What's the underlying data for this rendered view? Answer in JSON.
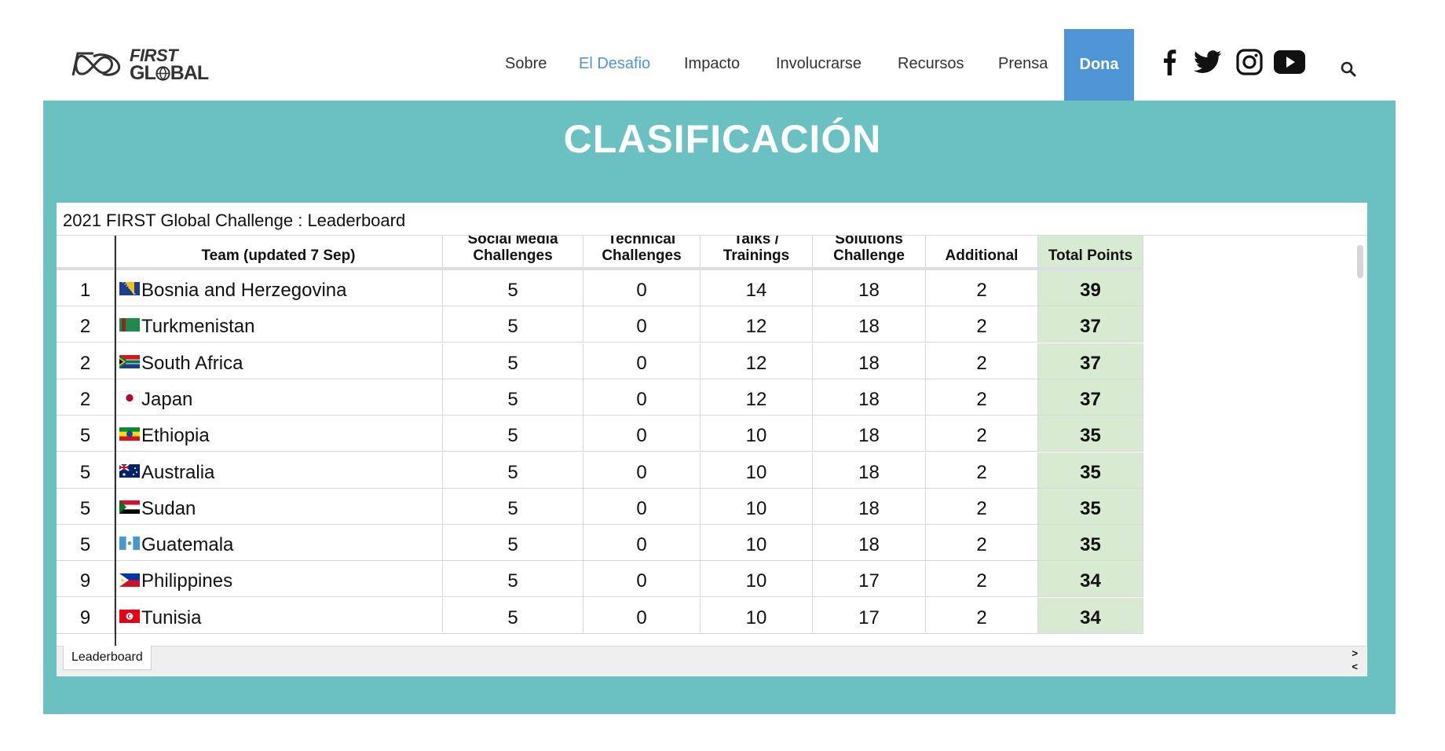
{
  "brand": {
    "line1": "FIRST",
    "line2": "GL",
    "line2b": "BAL"
  },
  "nav": {
    "items": [
      {
        "label": "Sobre"
      },
      {
        "label": "El Desafio"
      },
      {
        "label": "Impacto"
      },
      {
        "label": "Involucrarse"
      },
      {
        "label": "Recursos"
      },
      {
        "label": "Prensa"
      }
    ],
    "donate": "Dona",
    "social": [
      "facebook-icon",
      "twitter-icon",
      "instagram-icon",
      "youtube-icon"
    ],
    "active_color": "#4e95d6"
  },
  "banner": {
    "title": "CLASIFICACIÓN",
    "color": "#6bc0c2"
  },
  "sheet": {
    "title": "2021 FIRST Global Challenge : Leaderboard",
    "columns": [
      {
        "key": "rank",
        "label": ""
      },
      {
        "key": "team",
        "label": "Team (updated 7 Sep)"
      },
      {
        "key": "social",
        "label": "Social Media Challenges"
      },
      {
        "key": "technical",
        "label": "Technical Challenges"
      },
      {
        "key": "talks",
        "label": "Talks / Trainings"
      },
      {
        "key": "solutions",
        "label": "Solutions Challenge"
      },
      {
        "key": "additional",
        "label": "Additional"
      },
      {
        "key": "total",
        "label": "Total Points"
      }
    ],
    "rows": [
      {
        "rank": "1",
        "team": "Bosnia and Herzegovina",
        "flag": "BA",
        "social": "5",
        "technical": "0",
        "talks": "14",
        "solutions": "18",
        "additional": "2",
        "total": "39"
      },
      {
        "rank": "2",
        "team": "Turkmenistan",
        "flag": "TM",
        "social": "5",
        "technical": "0",
        "talks": "12",
        "solutions": "18",
        "additional": "2",
        "total": "37"
      },
      {
        "rank": "2",
        "team": "South Africa",
        "flag": "ZA",
        "social": "5",
        "technical": "0",
        "talks": "12",
        "solutions": "18",
        "additional": "2",
        "total": "37"
      },
      {
        "rank": "2",
        "team": "Japan",
        "flag": "JP",
        "social": "5",
        "technical": "0",
        "talks": "12",
        "solutions": "18",
        "additional": "2",
        "total": "37"
      },
      {
        "rank": "5",
        "team": "Ethiopia",
        "flag": "ET",
        "social": "5",
        "technical": "0",
        "talks": "10",
        "solutions": "18",
        "additional": "2",
        "total": "35"
      },
      {
        "rank": "5",
        "team": "Australia",
        "flag": "AU",
        "social": "5",
        "technical": "0",
        "talks": "10",
        "solutions": "18",
        "additional": "2",
        "total": "35"
      },
      {
        "rank": "5",
        "team": "Sudan",
        "flag": "SD",
        "social": "5",
        "technical": "0",
        "talks": "10",
        "solutions": "18",
        "additional": "2",
        "total": "35"
      },
      {
        "rank": "5",
        "team": "Guatemala",
        "flag": "GT",
        "social": "5",
        "technical": "0",
        "talks": "10",
        "solutions": "18",
        "additional": "2",
        "total": "35"
      },
      {
        "rank": "9",
        "team": "Philippines",
        "flag": "PH",
        "social": "5",
        "technical": "0",
        "talks": "10",
        "solutions": "17",
        "additional": "2",
        "total": "34"
      },
      {
        "rank": "9",
        "team": "Tunisia",
        "flag": "TN",
        "social": "5",
        "technical": "0",
        "talks": "10",
        "solutions": "17",
        "additional": "2",
        "total": "34"
      }
    ],
    "total_color": "#d9ead3",
    "sheet_tab": "Leaderboard",
    "tab_arrows": [
      ">",
      "<"
    ]
  }
}
